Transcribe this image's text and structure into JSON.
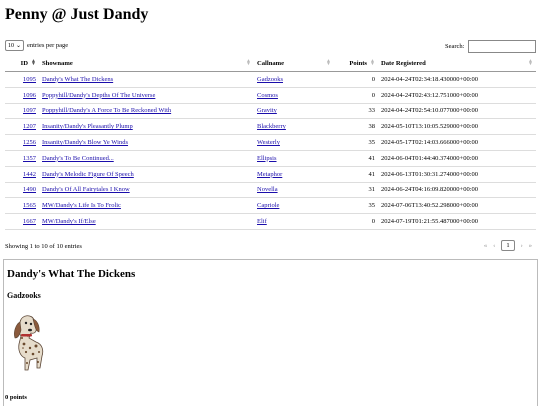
{
  "page": {
    "title": "Penny @ Just Dandy"
  },
  "controls": {
    "length_value": "10",
    "length_suffix": "entries per page",
    "search_label": "Search:"
  },
  "table": {
    "headers": [
      "ID",
      "Showname",
      "Callname",
      "Points",
      "Date Registered"
    ],
    "rows": [
      {
        "id": "1095",
        "showname": "Dandy's What The Dickens",
        "callname": "Gadzooks",
        "points": "0",
        "date": "2024-04-24T02:34:18.430000+00:00"
      },
      {
        "id": "1096",
        "showname": "Poppyhill/Dandy's Depths Of The Universe",
        "callname": "Cosmos",
        "points": "0",
        "date": "2024-04-24T02:43:12.751000+00:00"
      },
      {
        "id": "1097",
        "showname": "Poppyhill/Dandy's A Force To Be Reckoned With",
        "callname": "Gravity",
        "points": "33",
        "date": "2024-04-24T02:54:10.077000+00:00"
      },
      {
        "id": "1207",
        "showname": "Insanity/Dandy's Pleasantly Plump",
        "callname": "Blackberry",
        "points": "38",
        "date": "2024-05-10T13:10:05.529000+00:00"
      },
      {
        "id": "1256",
        "showname": "Insanity/Dandy's Blow Ye Winds",
        "callname": "Westerly",
        "points": "35",
        "date": "2024-05-17T02:14:03.666000+00:00"
      },
      {
        "id": "1357",
        "showname": "Dandy's To Be Continued...",
        "callname": "Ellipsis",
        "points": "41",
        "date": "2024-06-04T01:44:40.374000+00:00"
      },
      {
        "id": "1442",
        "showname": "Dandy's Melodic Figure Of Speech",
        "callname": "Metaphor",
        "points": "41",
        "date": "2024-06-13T01:30:31.274000+00:00"
      },
      {
        "id": "1490",
        "showname": "Dandy's Of All Fairytales I Know",
        "callname": "Novella",
        "points": "31",
        "date": "2024-06-24T04:16:09.820000+00:00"
      },
      {
        "id": "1565",
        "showname": "MW/Dandy's Life Is To Frolic",
        "callname": "Capriole",
        "points": "35",
        "date": "2024-07-06T13:40:52.298000+00:00"
      },
      {
        "id": "1667",
        "showname": "MW/Dandy's If/Else",
        "callname": "Elif",
        "points": "0",
        "date": "2024-07-19T01:21:55.487000+00:00"
      }
    ]
  },
  "footer": {
    "info": "Showing 1 to 10 of 10 entries",
    "pager": [
      "«",
      "‹",
      "1",
      "›",
      "»"
    ]
  },
  "detail": {
    "showname": "Dandy's What The Dickens",
    "callname": "Gadzooks",
    "points": "0 points",
    "image_icon": "dog-illustration"
  }
}
